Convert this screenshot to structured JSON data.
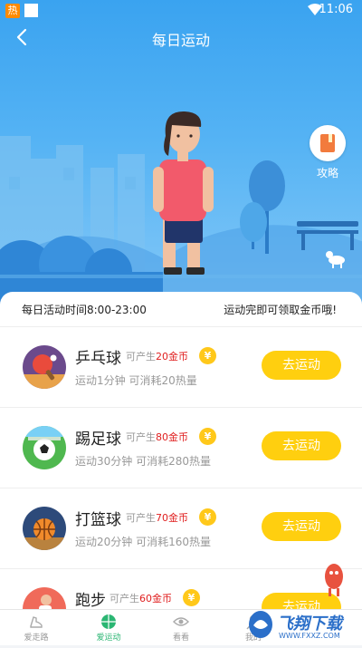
{
  "status_bar": {
    "hot_badge": "热",
    "time": "11:06"
  },
  "header": {
    "title": "每日运动"
  },
  "guide": {
    "label": "攻略"
  },
  "info": {
    "hours": "每日活动时间8:00-23:00",
    "hint": "运动完即可领取金币哦!"
  },
  "activities": [
    {
      "name": "乒乓球",
      "yield_prefix": "可产生",
      "coins": "20金币",
      "desc": "运动1分钟 可消耗20热量",
      "button": "去运动",
      "icon": "ping-pong-icon"
    },
    {
      "name": "踢足球",
      "yield_prefix": "可产生",
      "coins": "80金币",
      "desc": "运动30分钟 可消耗280热量",
      "button": "去运动",
      "icon": "soccer-ball-icon"
    },
    {
      "name": "打篮球",
      "yield_prefix": "可产生",
      "coins": "70金币",
      "desc": "运动20分钟 可消耗160热量",
      "button": "去运动",
      "icon": "basketball-icon"
    },
    {
      "name": "跑步",
      "yield_prefix": "可产生",
      "coins": "60金币",
      "desc": "",
      "button": "去运动",
      "icon": "running-icon"
    }
  ],
  "coin_symbol": "¥",
  "tabs": [
    {
      "label": "爱走路",
      "icon": "shoe-icon",
      "active": false
    },
    {
      "label": "爱运动",
      "icon": "ball-icon",
      "active": true
    },
    {
      "label": "看看",
      "icon": "eye-icon",
      "active": false
    },
    {
      "label": "我的",
      "icon": "user-icon",
      "active": false
    }
  ],
  "watermark": {
    "text": "飞翔下载",
    "url_text": "WWW.FXXZ.COM"
  },
  "colors": {
    "primary_blue": "#3aa3f0",
    "button_yellow": "#ffcf0f",
    "coin_red": "#e02020",
    "active_green": "#2bb673"
  }
}
